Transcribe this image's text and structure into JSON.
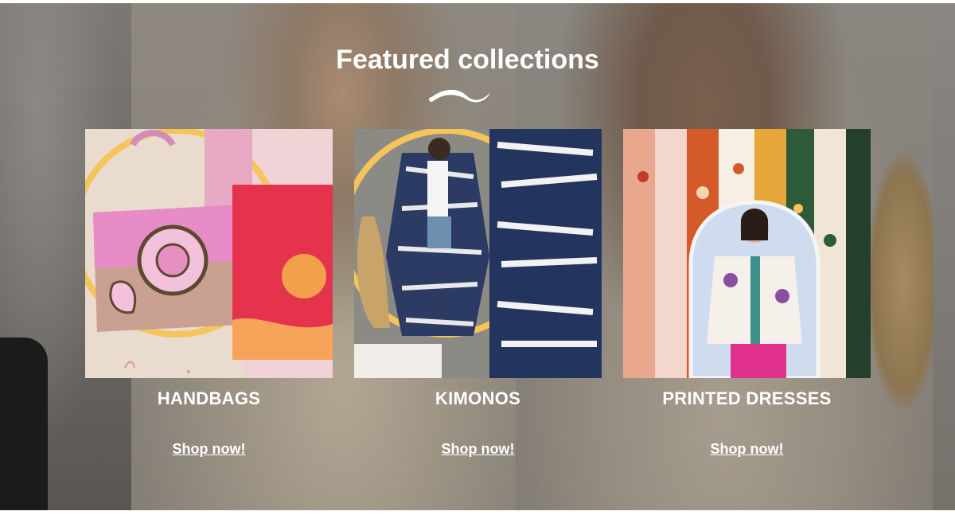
{
  "section": {
    "title": "Featured collections"
  },
  "collections": [
    {
      "title": "HANDBAGS",
      "link": "Shop now!",
      "image": "handbags-photo"
    },
    {
      "title": "KIMONOS",
      "link": "Shop now!",
      "image": "kimono-photo"
    },
    {
      "title": "PRINTED DRESSES",
      "link": "Shop now!",
      "image": "printed-dresses-photo"
    }
  ],
  "colors": {
    "accent_ring": "#f5c45a",
    "text": "#ffffff"
  }
}
